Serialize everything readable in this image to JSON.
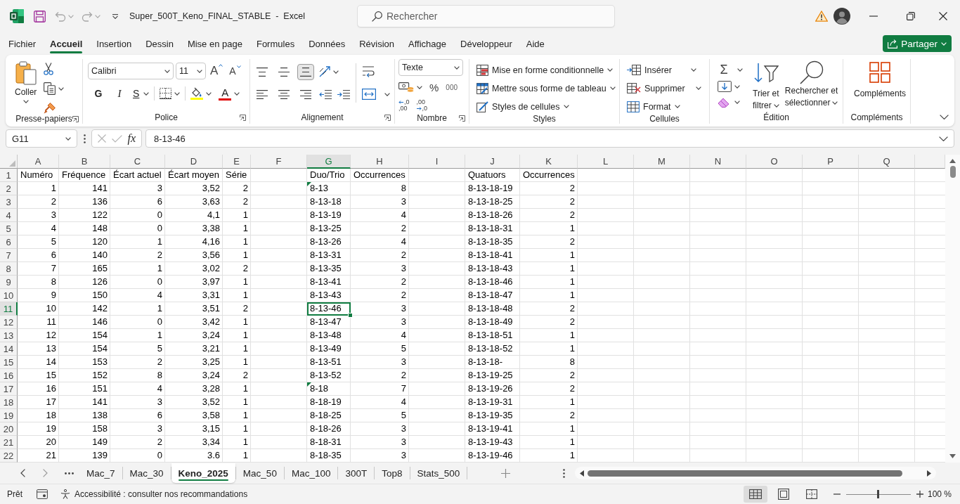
{
  "title_bar": {
    "quick_access": [
      {
        "kind": "save",
        "disabled": false
      },
      {
        "kind": "undo",
        "disabled": true
      },
      {
        "kind": "redo",
        "disabled": true
      }
    ],
    "title": "Super_500T_Keno_FINAL_STABLE  -  Excel",
    "search": {
      "placeholder": "Rechercher"
    }
  },
  "menu": {
    "tabs": [
      {
        "label": "Fichier",
        "selected": false
      },
      {
        "label": "Accueil",
        "selected": true
      },
      {
        "label": "Insertion",
        "selected": false
      },
      {
        "label": "Dessin",
        "selected": false
      },
      {
        "label": "Mise en page",
        "selected": false
      },
      {
        "label": "Formules",
        "selected": false
      },
      {
        "label": "Données",
        "selected": false
      },
      {
        "label": "Révision",
        "selected": false
      },
      {
        "label": "Affichage",
        "selected": false
      },
      {
        "label": "Développeur",
        "selected": false
      },
      {
        "label": "Aide",
        "selected": false
      }
    ],
    "share_button": "Partager"
  },
  "ribbon": {
    "groups": [
      {
        "kind": "clipboard",
        "label": "Presse-papiers",
        "launcher": true,
        "paste": "Coller"
      },
      {
        "kind": "font",
        "label": "Police",
        "launcher": true,
        "font_name": "Calibri",
        "font_size": "11",
        "grow": "A",
        "shrink": "A",
        "bold": "G",
        "italic": "I",
        "underline": "S",
        "font_color": "A"
      },
      {
        "kind": "alignment",
        "label": "Alignement",
        "launcher": true,
        "vertical": [
          {
            "kind": "top",
            "selected": false
          },
          {
            "kind": "middle",
            "selected": false
          },
          {
            "kind": "bottom",
            "selected": true
          }
        ],
        "horizontal": [
          {
            "kind": "left",
            "selected": false
          },
          {
            "kind": "center",
            "selected": false
          },
          {
            "kind": "right",
            "selected": false
          }
        ]
      },
      {
        "kind": "number",
        "label": "Nombre",
        "launcher": true,
        "format": "Texte",
        "percent": "%",
        "thousands": "000",
        "increase_decimal": [
          ",0",
          ",00"
        ],
        "decrease_decimal": [
          ",00",
          ",0"
        ]
      },
      {
        "kind": "styles",
        "label": "Styles",
        "launcher": false,
        "commands": [
          {
            "kind": "conditional",
            "label": "Mise en forme conditionnelle"
          },
          {
            "kind": "table",
            "label": "Mettre sous forme de tableau"
          },
          {
            "kind": "cell_styles",
            "label": "Styles de cellules"
          }
        ]
      },
      {
        "kind": "cells",
        "label": "Cellules",
        "launcher": false,
        "commands": [
          {
            "kind": "insert",
            "label": "Insérer"
          },
          {
            "kind": "delete",
            "label": "Supprimer"
          },
          {
            "kind": "format",
            "label": "Format"
          }
        ]
      },
      {
        "kind": "editing",
        "label": "Édition",
        "launcher": false,
        "sum": "Σ",
        "sort_filter": [
          "Trier et",
          "filtrer"
        ],
        "find_select": [
          "Rechercher et",
          "sélectionner"
        ]
      },
      {
        "kind": "addins",
        "label": "Compléments",
        "launcher": false,
        "button": "Compléments"
      }
    ]
  },
  "formula_bar": {
    "name_box": "G11",
    "cancel_disabled": true,
    "enter_disabled": true,
    "function_label": "fx",
    "formula": "8-13-46"
  },
  "sheet": {
    "columns": [
      {
        "letter": "A",
        "selected": false
      },
      {
        "letter": "B",
        "selected": false
      },
      {
        "letter": "C",
        "selected": false
      },
      {
        "letter": "D",
        "selected": false
      },
      {
        "letter": "E",
        "selected": false
      },
      {
        "letter": "F",
        "selected": false
      },
      {
        "letter": "G",
        "selected": true
      },
      {
        "letter": "H",
        "selected": false
      },
      {
        "letter": "I",
        "selected": false
      },
      {
        "letter": "J",
        "selected": false
      },
      {
        "letter": "K",
        "selected": false
      },
      {
        "letter": "L",
        "selected": false
      },
      {
        "letter": "M",
        "selected": false
      },
      {
        "letter": "N",
        "selected": false
      },
      {
        "letter": "O",
        "selected": false
      },
      {
        "letter": "P",
        "selected": false
      },
      {
        "letter": "Q",
        "selected": false
      }
    ],
    "rows": [
      {
        "kind": "header",
        "number": "1",
        "selected": false,
        "numero": "Numéro",
        "frequence": "Fréquence",
        "ecart_actuel": "Écart actuel",
        "ecart_moyen": "Écart moyen",
        "serie": "Série",
        "duo_trio": "Duo/Trio",
        "duo_trio_flagged": false,
        "occurrences": "Occurrences",
        "quatuors": "Quatuors",
        "occurrences_quatuors": "Occurrences"
      },
      {
        "kind": "data",
        "number": "2",
        "selected": false,
        "numero": "1",
        "frequence": "141",
        "ecart_actuel": "3",
        "ecart_moyen": "3,52",
        "serie": "2",
        "duo_trio": "8-13",
        "duo_trio_flagged": true,
        "occurrences": "8",
        "quatuors": "8-13-18-19",
        "occurrences_quatuors": "2"
      },
      {
        "kind": "data",
        "number": "3",
        "selected": false,
        "numero": "2",
        "frequence": "136",
        "ecart_actuel": "6",
        "ecart_moyen": "3,63",
        "serie": "2",
        "duo_trio": "8-13-18",
        "duo_trio_flagged": false,
        "occurrences": "3",
        "quatuors": "8-13-18-25",
        "occurrences_quatuors": "2"
      },
      {
        "kind": "data",
        "number": "4",
        "selected": false,
        "numero": "3",
        "frequence": "122",
        "ecart_actuel": "0",
        "ecart_moyen": "4,1",
        "serie": "1",
        "duo_trio": "8-13-19",
        "duo_trio_flagged": false,
        "occurrences": "4",
        "quatuors": "8-13-18-26",
        "occurrences_quatuors": "2"
      },
      {
        "kind": "data",
        "number": "5",
        "selected": false,
        "numero": "4",
        "frequence": "148",
        "ecart_actuel": "0",
        "ecart_moyen": "3,38",
        "serie": "1",
        "duo_trio": "8-13-25",
        "duo_trio_flagged": false,
        "occurrences": "2",
        "quatuors": "8-13-18-31",
        "occurrences_quatuors": "1"
      },
      {
        "kind": "data",
        "number": "6",
        "selected": false,
        "numero": "5",
        "frequence": "120",
        "ecart_actuel": "1",
        "ecart_moyen": "4,16",
        "serie": "1",
        "duo_trio": "8-13-26",
        "duo_trio_flagged": false,
        "occurrences": "4",
        "quatuors": "8-13-18-35",
        "occurrences_quatuors": "2"
      },
      {
        "kind": "data",
        "number": "7",
        "selected": false,
        "numero": "6",
        "frequence": "140",
        "ecart_actuel": "2",
        "ecart_moyen": "3,56",
        "serie": "1",
        "duo_trio": "8-13-31",
        "duo_trio_flagged": false,
        "occurrences": "2",
        "quatuors": "8-13-18-41",
        "occurrences_quatuors": "1"
      },
      {
        "kind": "data",
        "number": "8",
        "selected": false,
        "numero": "7",
        "frequence": "165",
        "ecart_actuel": "1",
        "ecart_moyen": "3,02",
        "serie": "2",
        "duo_trio": "8-13-35",
        "duo_trio_flagged": false,
        "occurrences": "3",
        "quatuors": "8-13-18-43",
        "occurrences_quatuors": "1"
      },
      {
        "kind": "data",
        "number": "9",
        "selected": false,
        "numero": "8",
        "frequence": "126",
        "ecart_actuel": "0",
        "ecart_moyen": "3,97",
        "serie": "1",
        "duo_trio": "8-13-41",
        "duo_trio_flagged": false,
        "occurrences": "2",
        "quatuors": "8-13-18-46",
        "occurrences_quatuors": "1"
      },
      {
        "kind": "data",
        "number": "10",
        "selected": false,
        "numero": "9",
        "frequence": "150",
        "ecart_actuel": "4",
        "ecart_moyen": "3,31",
        "serie": "1",
        "duo_trio": "8-13-43",
        "duo_trio_flagged": false,
        "occurrences": "2",
        "quatuors": "8-13-18-47",
        "occurrences_quatuors": "1"
      },
      {
        "kind": "data",
        "number": "11",
        "selected": true,
        "numero": "10",
        "frequence": "142",
        "ecart_actuel": "1",
        "ecart_moyen": "3,51",
        "serie": "2",
        "duo_trio": "8-13-46",
        "duo_trio_flagged": false,
        "occurrences": "3",
        "quatuors": "8-13-18-48",
        "occurrences_quatuors": "2"
      },
      {
        "kind": "data",
        "number": "12",
        "selected": false,
        "numero": "11",
        "frequence": "146",
        "ecart_actuel": "0",
        "ecart_moyen": "3,42",
        "serie": "1",
        "duo_trio": "8-13-47",
        "duo_trio_flagged": false,
        "occurrences": "3",
        "quatuors": "8-13-18-49",
        "occurrences_quatuors": "2"
      },
      {
        "kind": "data",
        "number": "13",
        "selected": false,
        "numero": "12",
        "frequence": "154",
        "ecart_actuel": "1",
        "ecart_moyen": "3,24",
        "serie": "1",
        "duo_trio": "8-13-48",
        "duo_trio_flagged": false,
        "occurrences": "4",
        "quatuors": "8-13-18-51",
        "occurrences_quatuors": "1"
      },
      {
        "kind": "data",
        "number": "14",
        "selected": false,
        "numero": "13",
        "frequence": "154",
        "ecart_actuel": "5",
        "ecart_moyen": "3,21",
        "serie": "1",
        "duo_trio": "8-13-49",
        "duo_trio_flagged": false,
        "occurrences": "5",
        "quatuors": "8-13-18-52",
        "occurrences_quatuors": "1"
      },
      {
        "kind": "data",
        "number": "15",
        "selected": false,
        "numero": "14",
        "frequence": "153",
        "ecart_actuel": "2",
        "ecart_moyen": "3,25",
        "serie": "1",
        "duo_trio": "8-13-51",
        "duo_trio_flagged": false,
        "occurrences": "3",
        "quatuors": "8-13-18-",
        "occurrences_quatuors": "8"
      },
      {
        "kind": "data",
        "number": "16",
        "selected": false,
        "numero": "15",
        "frequence": "152",
        "ecart_actuel": "8",
        "ecart_moyen": "3,24",
        "serie": "2",
        "duo_trio": "8-13-52",
        "duo_trio_flagged": false,
        "occurrences": "2",
        "quatuors": "8-13-19-25",
        "occurrences_quatuors": "2"
      },
      {
        "kind": "data",
        "number": "17",
        "selected": false,
        "numero": "16",
        "frequence": "151",
        "ecart_actuel": "4",
        "ecart_moyen": "3,28",
        "serie": "1",
        "duo_trio": "8-18",
        "duo_trio_flagged": true,
        "occurrences": "7",
        "quatuors": "8-13-19-26",
        "occurrences_quatuors": "2"
      },
      {
        "kind": "data",
        "number": "18",
        "selected": false,
        "numero": "17",
        "frequence": "141",
        "ecart_actuel": "3",
        "ecart_moyen": "3,52",
        "serie": "1",
        "duo_trio": "8-18-19",
        "duo_trio_flagged": false,
        "occurrences": "4",
        "quatuors": "8-13-19-31",
        "occurrences_quatuors": "1"
      },
      {
        "kind": "data",
        "number": "19",
        "selected": false,
        "numero": "18",
        "frequence": "138",
        "ecart_actuel": "6",
        "ecart_moyen": "3,58",
        "serie": "1",
        "duo_trio": "8-18-25",
        "duo_trio_flagged": false,
        "occurrences": "5",
        "quatuors": "8-13-19-35",
        "occurrences_quatuors": "2"
      },
      {
        "kind": "data",
        "number": "20",
        "selected": false,
        "numero": "19",
        "frequence": "158",
        "ecart_actuel": "3",
        "ecart_moyen": "3,15",
        "serie": "1",
        "duo_trio": "8-18-26",
        "duo_trio_flagged": false,
        "occurrences": "3",
        "quatuors": "8-13-19-41",
        "occurrences_quatuors": "1"
      },
      {
        "kind": "data",
        "number": "21",
        "selected": false,
        "numero": "20",
        "frequence": "149",
        "ecart_actuel": "2",
        "ecart_moyen": "3,34",
        "serie": "1",
        "duo_trio": "8-18-31",
        "duo_trio_flagged": false,
        "occurrences": "3",
        "quatuors": "8-13-19-43",
        "occurrences_quatuors": "1"
      },
      {
        "kind": "data",
        "number": "22",
        "selected": false,
        "numero": "21",
        "frequence": "139",
        "ecart_actuel": "0",
        "ecart_moyen": "3.6",
        "serie": "1",
        "duo_trio": "8-18-35",
        "duo_trio_flagged": false,
        "occurrences": "3",
        "quatuors": "8-13-19-46",
        "occurrences_quatuors": "1"
      }
    ]
  },
  "sheet_tabs": {
    "tabs": [
      {
        "name": "Mac_7",
        "selected": false
      },
      {
        "name": "Mac_30",
        "selected": false
      },
      {
        "name": "Keno_2025",
        "selected": true
      },
      {
        "name": "Mac_50",
        "selected": false
      },
      {
        "name": "Mac_100",
        "selected": false
      },
      {
        "name": "300T",
        "selected": false
      },
      {
        "name": "Top8",
        "selected": false
      },
      {
        "name": "Stats_500",
        "selected": false
      }
    ]
  },
  "status_bar": {
    "status": "Prêt",
    "accessibility": "Accessibilité : consulter nos recommandations",
    "views": [
      {
        "kind": "normal",
        "selected": true
      },
      {
        "kind": "page_layout",
        "selected": false
      },
      {
        "kind": "page_break",
        "selected": false
      }
    ],
    "zoom": {
      "level": 0.5,
      "reading": "100 %"
    }
  }
}
